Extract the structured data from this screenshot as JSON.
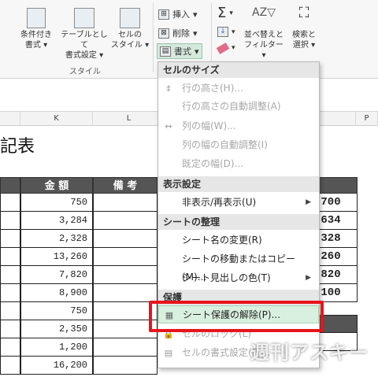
{
  "ribbon": {
    "cond_format": "条件付き",
    "cond_format2": "書式",
    "table_format": "テーブルとして",
    "table_format2": "書式設定",
    "cell_style": "セルの",
    "cell_style2": "スタイル",
    "styles_group": "スタイル",
    "insert": "挿入",
    "delete": "削除",
    "format": "書式",
    "sort_filter": "並べ替えと",
    "sort_filter2": "フィルター",
    "find_select": "検索と",
    "find_select2": "選択",
    "sigma": "Σ"
  },
  "columns": {
    "k": "K",
    "l": "L",
    "p": "P"
  },
  "sheet": {
    "title_fragment": "記表",
    "header_amount": "金 額",
    "header_note": "備 考",
    "amounts": [
      "750",
      "3,284",
      "2,328",
      "13,260",
      "7,820",
      "8,900",
      "750",
      "2,350",
      "1,200",
      "16,200"
    ],
    "right_values": [
      ",700",
      ",634",
      ",328",
      ",260",
      ",820",
      ",100"
    ]
  },
  "menu": {
    "sec_cell_size": "セルのサイズ",
    "row_height": "行の高さ(H)...",
    "autofit_row": "行の高さの自動調整(A)",
    "col_width": "列の幅(W)...",
    "autofit_col": "列の幅の自動調整(I)",
    "default_width": "既定の幅(D)...",
    "sec_visibility": "表示設定",
    "hide_unhide": "非表示/再表示(U)",
    "sec_organize": "シートの整理",
    "rename_sheet": "シート名の変更(R)",
    "move_copy": "シートの移動またはコピー(M)...",
    "tab_color": "シート見出しの色(T)",
    "sec_protection": "保護",
    "unprotect": "シート保護の解除(P)...",
    "lock_cell": "セルのロック(L)",
    "format_cells": "セルの書式設定(E)..."
  },
  "watermark": "週刊アスキー"
}
